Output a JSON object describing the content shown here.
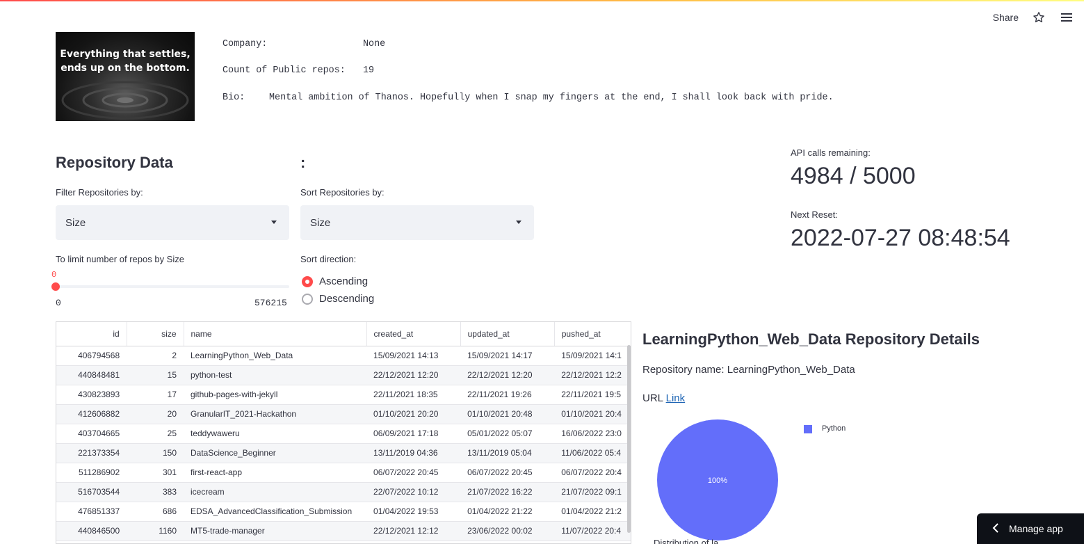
{
  "header": {
    "share_label": "Share",
    "star_icon": "star-icon",
    "menu_icon": "hamburger-menu-icon"
  },
  "avatar": {
    "line1": "Everything that settles,",
    "line2": "ends up on the bottom."
  },
  "profile": {
    "company_label": "Company:",
    "company_value": "None",
    "repos_label": "Count of Public repos:",
    "repos_value": "19",
    "bio_label": "Bio:",
    "bio_value": "Mental ambition of Thanos. Hopefully when I snap my fingers at the end, I shall look back with pride."
  },
  "repo_section": {
    "title": "Repository Data",
    "colon": ":",
    "filter_label": "Filter Repositories by:",
    "filter_value": "Size",
    "sort_label": "Sort Repositories by:",
    "sort_value": "Size",
    "limit_label": "To limit number of repos by Size",
    "slider_value": "0",
    "slider_min": "0",
    "slider_max": "576215",
    "direction_label": "Sort direction:",
    "direction_options": [
      "Ascending",
      "Descending"
    ],
    "direction_selected": "Ascending"
  },
  "api": {
    "calls_label": "API calls remaining:",
    "calls_value": "4984 / 5000",
    "reset_label": "Next Reset:",
    "reset_value": "2022-07-27 08:48:54"
  },
  "table": {
    "columns": [
      "id",
      "size",
      "name",
      "created_at",
      "updated_at",
      "pushed_at"
    ],
    "rows": [
      [
        "406794568",
        "2",
        "LearningPython_Web_Data",
        "15/09/2021 14:13",
        "15/09/2021 14:17",
        "15/09/2021 14:1"
      ],
      [
        "440848481",
        "15",
        "python-test",
        "22/12/2021 12:20",
        "22/12/2021 12:20",
        "22/12/2021 12:2"
      ],
      [
        "430823893",
        "17",
        "github-pages-with-jekyll",
        "22/11/2021 18:35",
        "22/11/2021 19:26",
        "22/11/2021 19:5"
      ],
      [
        "412606882",
        "20",
        "GranularIT_2021-Hackathon",
        "01/10/2021 20:20",
        "01/10/2021 20:48",
        "01/10/2021 20:4"
      ],
      [
        "403704665",
        "25",
        "teddywaweru",
        "06/09/2021 17:18",
        "05/01/2022 05:07",
        "16/06/2022 23:0"
      ],
      [
        "221373354",
        "150",
        "DataScience_Beginner",
        "13/11/2019 04:36",
        "13/11/2019 05:04",
        "11/06/2022 05:4"
      ],
      [
        "511286902",
        "301",
        "first-react-app",
        "06/07/2022 20:45",
        "06/07/2022 20:45",
        "06/07/2022 20:4"
      ],
      [
        "516703544",
        "383",
        "icecream",
        "22/07/2022 10:12",
        "21/07/2022 16:22",
        "21/07/2022 09:1"
      ],
      [
        "476851337",
        "686",
        "EDSA_AdvancedClassification_Submission",
        "01/04/2022 19:53",
        "01/04/2022 21:22",
        "01/04/2022 21:2"
      ],
      [
        "440846500",
        "1160",
        "MT5-trade-manager",
        "22/12/2021 12:12",
        "23/06/2022 00:02",
        "11/07/2022 20:4"
      ]
    ]
  },
  "details": {
    "title": "LearningPython_Web_Data Repository Details",
    "repo_name_text": "Repository name: LearningPython_Web_Data",
    "url_label": "URL",
    "url_link_text": "Link",
    "cut_text": "Distribution of la"
  },
  "chart_data": {
    "type": "pie",
    "labels": [
      "Python"
    ],
    "values": [
      100
    ],
    "slice_labels": [
      "100%"
    ],
    "colors": [
      "#636efa"
    ],
    "legend": "right"
  },
  "manage_app": {
    "label": "Manage app",
    "icon": "chevron-left-icon"
  },
  "colors": {
    "accent": "#ff4b4b",
    "pie": "#636efa",
    "link": "#1a62b3",
    "input_bg": "#f0f2f6"
  }
}
